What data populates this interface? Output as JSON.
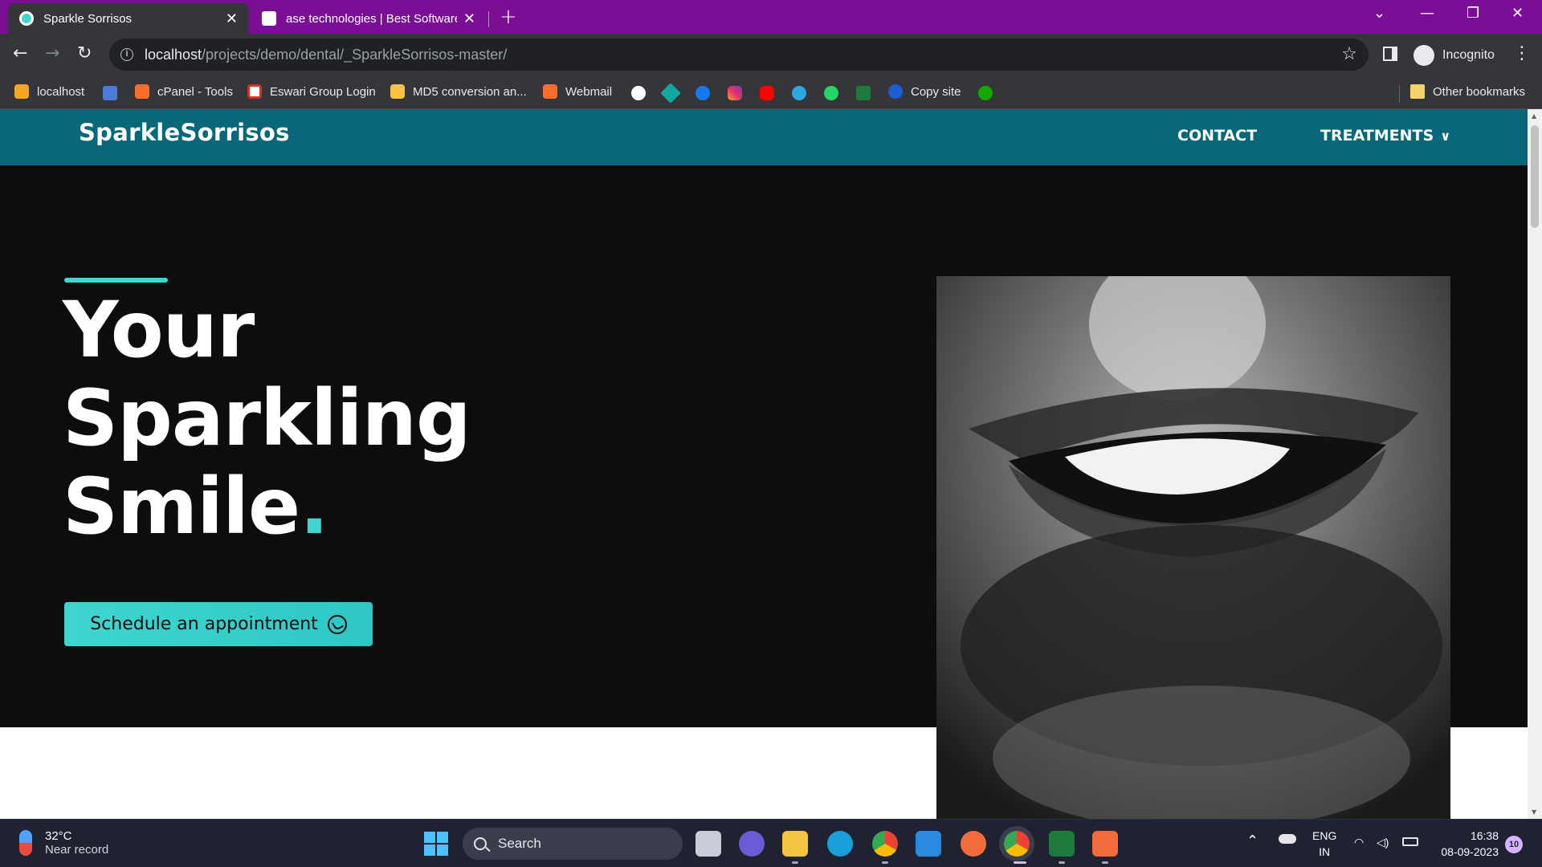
{
  "browser": {
    "tabs": [
      {
        "title": "Sparkle Sorrisos",
        "close": "✕",
        "active": true
      },
      {
        "title": "ase technologies | Best Software",
        "close": "✕",
        "active": false
      }
    ],
    "new_tab": "+",
    "url": {
      "host": "localhost",
      "path": "/projects/demo/dental/_SparkleSorrisos-master/"
    },
    "profile_label": "Incognito",
    "bookmarks": [
      {
        "label": "localhost",
        "color": "#f5a623"
      },
      {
        "label": "cPanel - Tools",
        "color": "#ff6c2c"
      },
      {
        "label": "Eswari Group Login",
        "color": "#ffffff"
      },
      {
        "label": "MD5 conversion an...",
        "color": "#f5c242"
      },
      {
        "label": "Webmail",
        "color": "#ff6c2c"
      },
      {
        "label": "Copy site",
        "color": "#1d5fd1"
      }
    ],
    "other_bookmarks": "Other bookmarks"
  },
  "site": {
    "brand": "SparkleSorrisos",
    "nav": {
      "contact": "CONTACT",
      "treatments": "TREATMENTS"
    },
    "hero": {
      "line1": "Your",
      "line2": "Sparkling",
      "line3": "Smile",
      "dot": ".",
      "cta_label": "Schedule an appointment"
    },
    "colors": {
      "accent": "#3ed6cf",
      "nav_bg": "#08687a",
      "hero_bg": "#0d0d0e"
    }
  },
  "taskbar": {
    "weather": {
      "temp": "32°C",
      "desc": "Near record"
    },
    "search_placeholder": "Search",
    "lang": {
      "top": "ENG",
      "bottom": "IN"
    },
    "time": "16:38",
    "date": "08-09-2023",
    "notifications": "10"
  }
}
